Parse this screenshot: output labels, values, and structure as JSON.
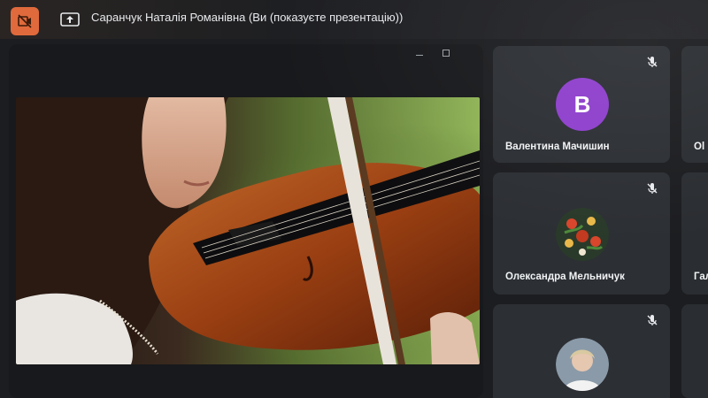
{
  "toolbar": {
    "camera_icon": "camera-off-icon",
    "present_icon": "present-screen-icon",
    "presentation_title": "Саранчук Наталія Романівна (Ви (показуєте презентацію))"
  },
  "stage": {
    "minimize_icon": "minimize-icon",
    "maximize_icon": "maximize-icon",
    "slide_image": "violinist-photo"
  },
  "participants": [
    {
      "name": "Валентина Мачишин",
      "avatar_letter": "B",
      "avatar_color": "#8e3fcc",
      "mic_icon": "mic-off-icon"
    },
    {
      "name": "Олександра Мельничук",
      "avatar": "painted-flower-avatar",
      "mic_icon": "mic-off-icon"
    },
    {
      "name": "",
      "avatar": "photo-avatar",
      "mic_icon": "mic-off-icon"
    }
  ],
  "peek_participants": [
    {
      "name": "Ol"
    },
    {
      "name": "Гал"
    },
    {
      "name": ""
    }
  ],
  "colors": {
    "accent": "#e06a3c",
    "tile_bg": "#2c2f34",
    "avatar_purple": "#8e3fcc"
  }
}
